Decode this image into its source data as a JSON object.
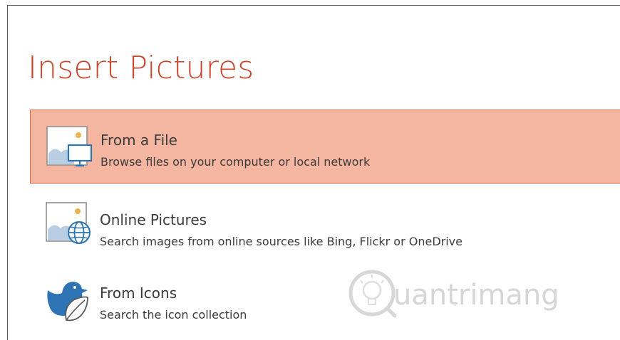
{
  "dialog": {
    "title": "Insert Pictures",
    "options": [
      {
        "label": "From a File",
        "description": "Browse files on your computer or local network",
        "icon": "picture-monitor-icon",
        "selected": true
      },
      {
        "label": "Online Pictures",
        "description": "Search images from online sources like Bing, Flickr or OneDrive",
        "icon": "picture-globe-icon",
        "selected": false
      },
      {
        "label": "From Icons",
        "description": "Search the icon collection",
        "icon": "bird-leaf-icon",
        "selected": false
      }
    ]
  },
  "watermark": {
    "text": "uantrimang",
    "icon": "lightbulb-logo-icon"
  },
  "colors": {
    "accent": "#c8472d",
    "selected_bg": "#f4b6a0",
    "selected_border": "#e06a48",
    "icon_blue": "#2e74b5"
  }
}
